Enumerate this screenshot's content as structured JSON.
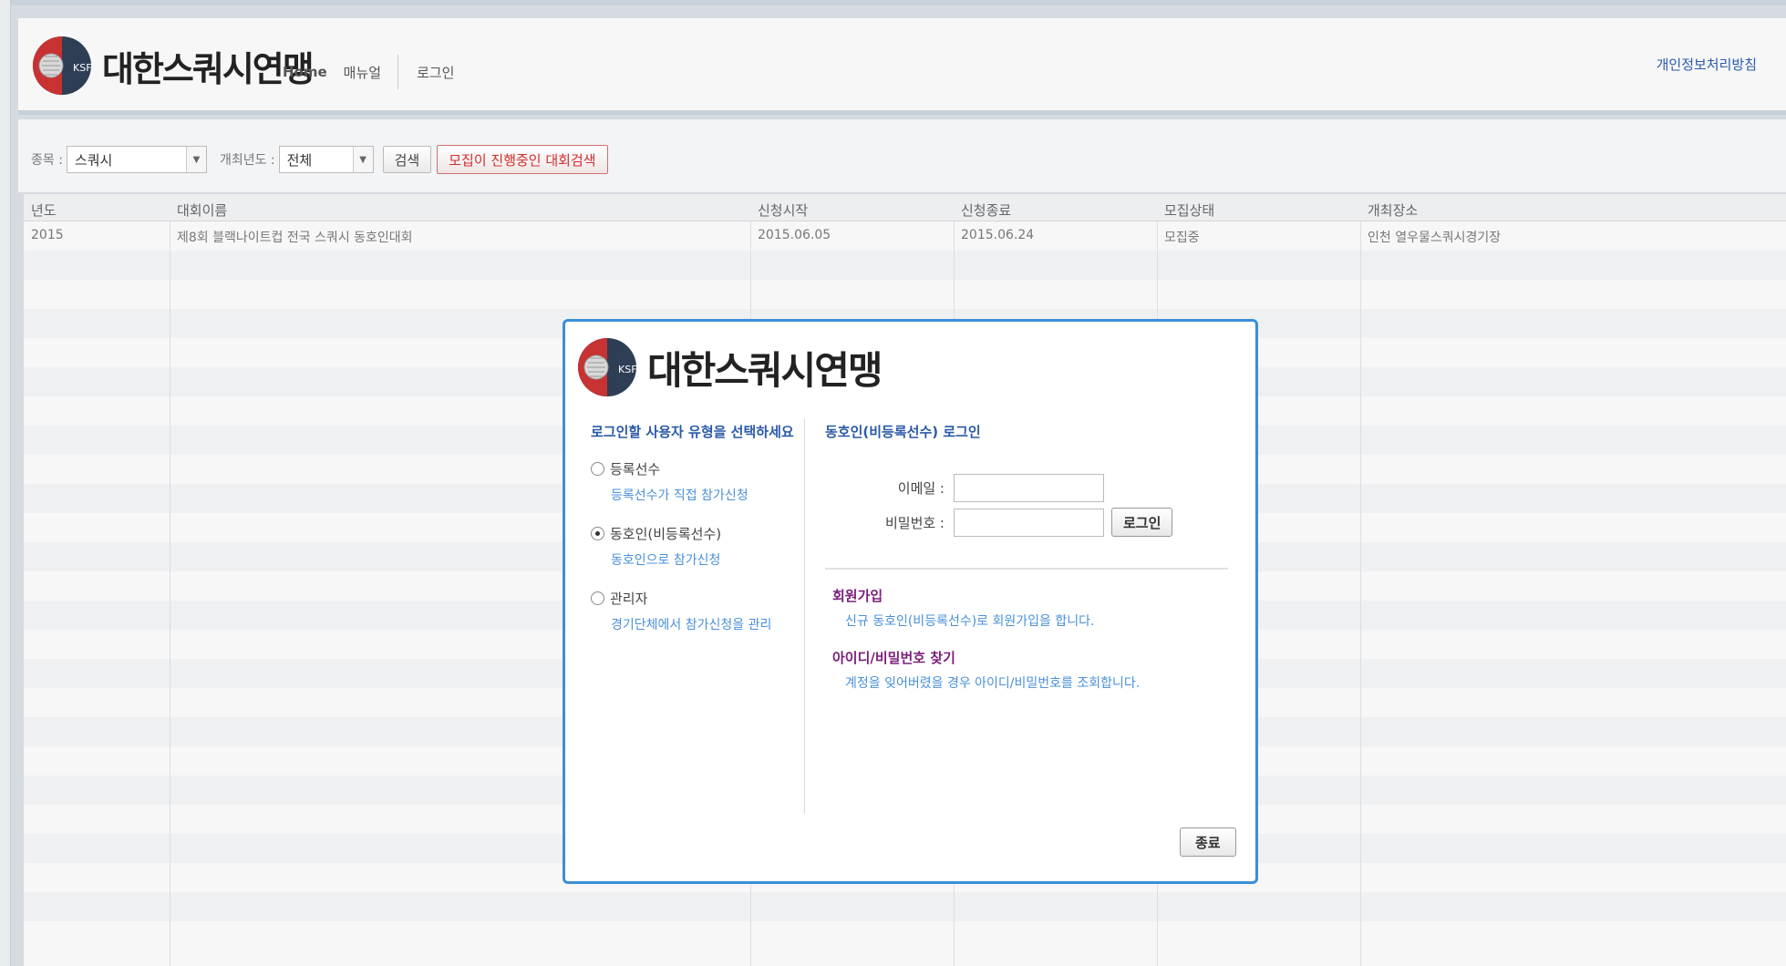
{
  "header": {
    "logo_text": "대한스쿼시연맹",
    "logo_badge": "KSF",
    "nav": {
      "home": "Home",
      "manual": "매뉴얼",
      "login": "로그인"
    },
    "privacy_link": "개인정보처리방침"
  },
  "filter": {
    "sport_label": "종목 :",
    "sport_value": "스쿼시",
    "year_label": "개최년도 :",
    "year_value": "전체",
    "search_button": "검색",
    "recruiting_button": "모집이 진행중인 대회검색"
  },
  "table": {
    "columns": [
      "년도",
      "대회이름",
      "신청시작",
      "신청종료",
      "모집상태",
      "개최장소"
    ],
    "rows": [
      [
        "2015",
        "제8회 블랙나이트컵 전국 스쿼시 동호인대회",
        "2015.06.05",
        "2015.06.24",
        "모집중",
        "인천 열우물스쿼시경기장"
      ]
    ]
  },
  "dialog": {
    "logo_text": "대한스쿼시연맹",
    "logo_badge": "KSF",
    "left_title": "로그인할 사용자 유형을 선택하세요",
    "options": [
      {
        "label": "등록선수",
        "desc": "등록선수가 직접 참가신청",
        "checked": false
      },
      {
        "label": "동호인(비등록선수)",
        "desc": "동호인으로 참가신청",
        "checked": true
      },
      {
        "label": "관리자",
        "desc": "경기단체에서 참가신청을 관리",
        "checked": false
      }
    ],
    "right_title": "동호인(비등록선수) 로그인",
    "email_label": "이메일 :",
    "password_label": "비밀번호 :",
    "login_button": "로그인",
    "signup_title": "회원가입",
    "signup_desc": "신규 동호인(비등록선수)로 회원가입을 합니다.",
    "find_title": "아이디/비밀번호 찾기",
    "find_desc": "계정을 잊어버렸을 경우 아이디/비밀번호를 조회합니다.",
    "close_button": "종료"
  },
  "colors": {
    "accent_blue": "#3a8fd8",
    "link_blue": "#4a90d9",
    "title_purple": "#7a1e7a",
    "recruit_red": "#d03030"
  }
}
